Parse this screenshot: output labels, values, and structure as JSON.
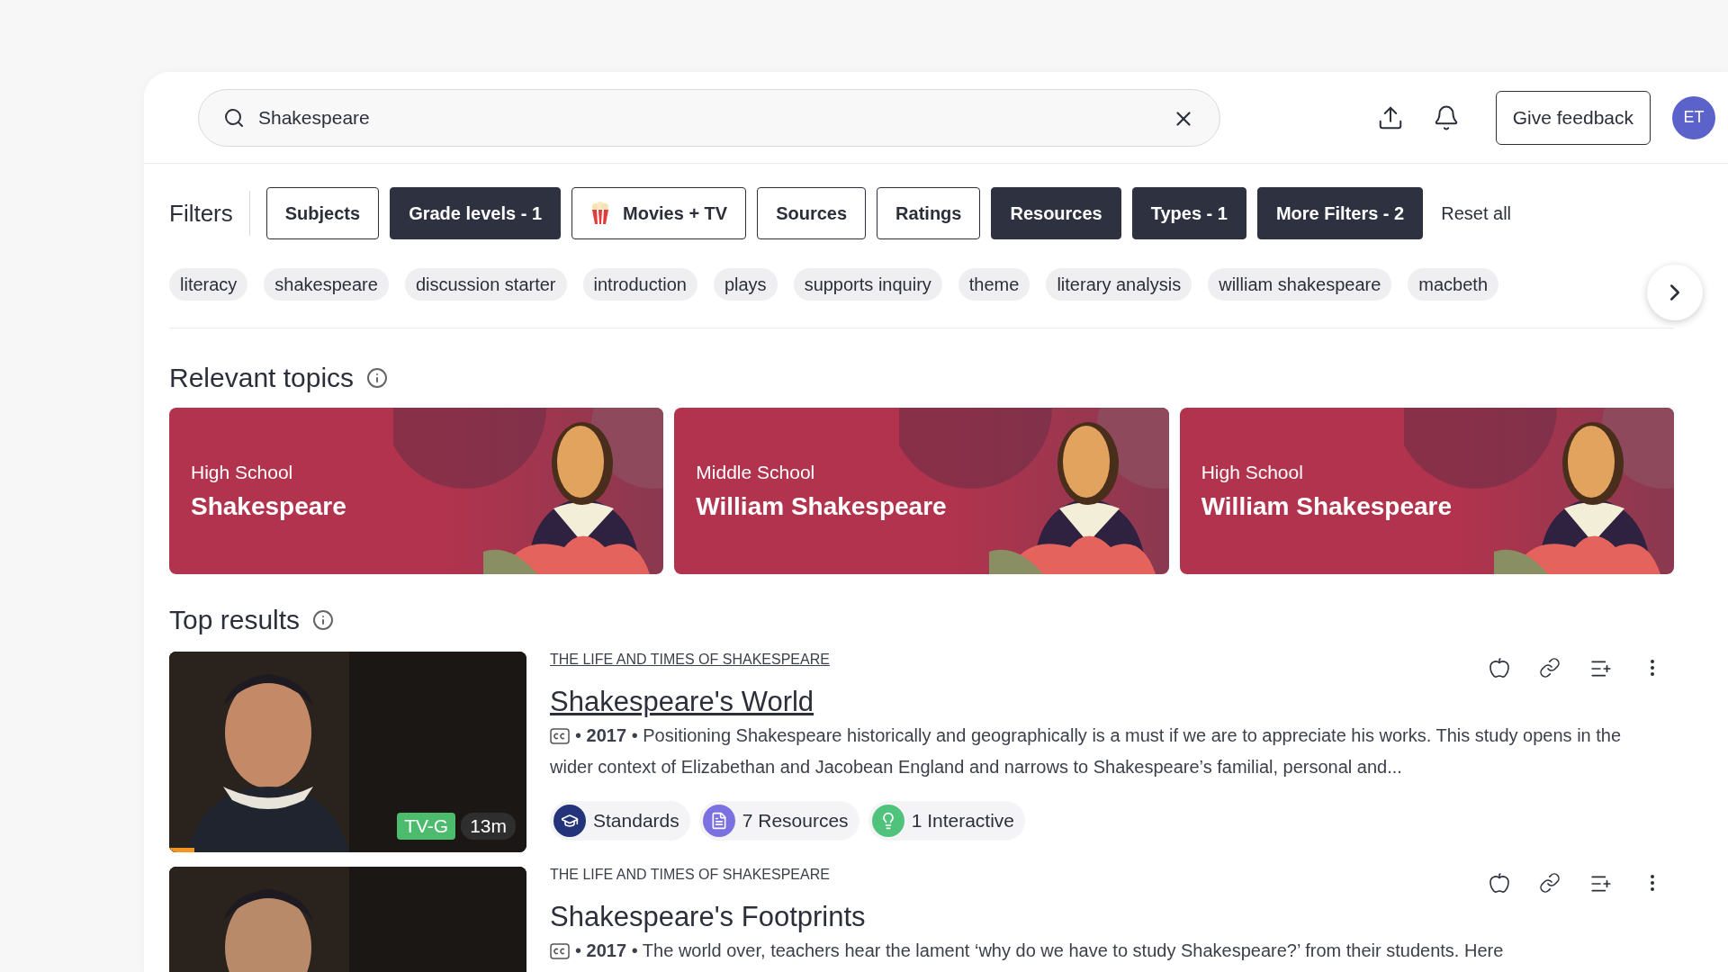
{
  "search": {
    "value": "Shakespeare"
  },
  "header": {
    "feedback": "Give feedback",
    "avatar": "ET"
  },
  "filters": {
    "label": "Filters",
    "reset": "Reset all",
    "buttons": [
      {
        "label": "Subjects",
        "active": false,
        "kind": "plain"
      },
      {
        "label": "Grade levels - 1",
        "active": true,
        "kind": "plain"
      },
      {
        "label": "Movies + TV",
        "active": false,
        "kind": "popcorn"
      },
      {
        "label": "Sources",
        "active": false,
        "kind": "plain"
      },
      {
        "label": "Ratings",
        "active": false,
        "kind": "plain"
      },
      {
        "label": "Resources",
        "active": true,
        "kind": "plain"
      },
      {
        "label": "Types - 1",
        "active": true,
        "kind": "plain"
      },
      {
        "label": "More Filters - 2",
        "active": true,
        "kind": "plain"
      }
    ]
  },
  "tags": [
    "literacy",
    "shakespeare",
    "discussion starter",
    "introduction",
    "plays",
    "supports inquiry",
    "theme",
    "literary analysis",
    "william shakespeare",
    "macbeth"
  ],
  "topics": {
    "heading": "Relevant topics",
    "cards": [
      {
        "level": "High School",
        "title": "Shakespeare"
      },
      {
        "level": "Middle School",
        "title": "William Shakespeare"
      },
      {
        "level": "High School",
        "title": "William Shakespeare"
      }
    ]
  },
  "results": {
    "heading": "Top results",
    "items": [
      {
        "series": "THE LIFE AND TIMES OF SHAKESPEARE",
        "title": "Shakespeare's World",
        "hovered": true,
        "separator": "•",
        "year": "2017",
        "description": "Positioning Shakespeare historically and geographically is a must if we are to appreciate his works. This study opens in the wider context of Elizabethan and Jacobean England and narrows to Shakespeare’s familial, personal and...",
        "rating": "TV-G",
        "duration": "13m",
        "level": 0.07,
        "pills": [
          {
            "kind": "standards",
            "label": "Standards"
          },
          {
            "kind": "resources",
            "label": "7 Resources"
          },
          {
            "kind": "interactive",
            "label": "1 Interactive"
          }
        ]
      },
      {
        "series": "THE LIFE AND TIMES OF SHAKESPEARE",
        "title": "Shakespeare's Footprints",
        "hovered": false,
        "separator": "•",
        "year": "2017",
        "description": "The world over, teachers hear the lament ‘why do we have to study Shakespeare?’ from their students. Here"
      }
    ]
  }
}
